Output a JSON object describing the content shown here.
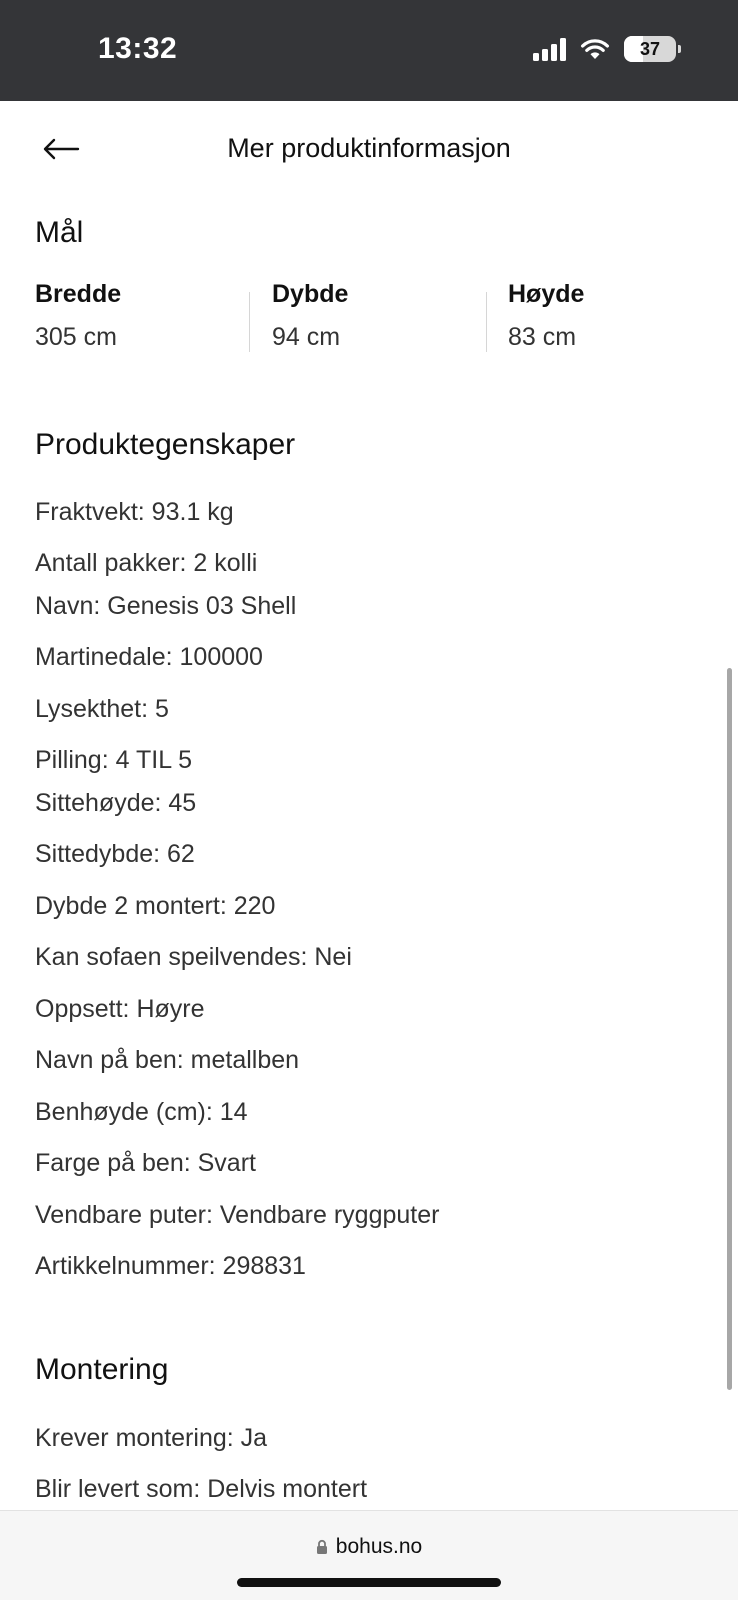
{
  "status_bar": {
    "time": "13:32",
    "battery": "37",
    "battery_level_percent": 37
  },
  "header": {
    "title": "Mer produktinformasjon",
    "back_icon": "arrow-left-icon"
  },
  "dimensions": {
    "title": "Mål",
    "items": [
      {
        "label": "Bredde",
        "value": "305 cm"
      },
      {
        "label": "Dybde",
        "value": "94 cm"
      },
      {
        "label": "Høyde",
        "value": "83 cm"
      }
    ]
  },
  "properties": {
    "title": "Produktegenskaper",
    "items": [
      "Fraktvekt: 93.1 kg",
      "Antall pakker: 2 kolli",
      "Navn: Genesis 03 Shell",
      "Martinedale: 100000",
      "Lysekthet: 5",
      "Pilling: 4 TIL 5",
      "Sittehøyde: 45",
      "Sittedybde: 62",
      "Dybde 2 montert: 220",
      "Kan sofaen speilvendes: Nei",
      "Oppsett: Høyre",
      "Navn på ben: metallben",
      "Benhøyde (cm): 14",
      "Farge på ben: Svart",
      "Vendbare puter: Vendbare ryggputer",
      "Artikkelnummer: 298831"
    ]
  },
  "assembly": {
    "title": "Montering",
    "items": [
      "Krever montering: Ja",
      "Blir levert som: Delvis montert"
    ]
  },
  "browser": {
    "url": "bohus.no",
    "lock_icon": "lock-icon"
  }
}
